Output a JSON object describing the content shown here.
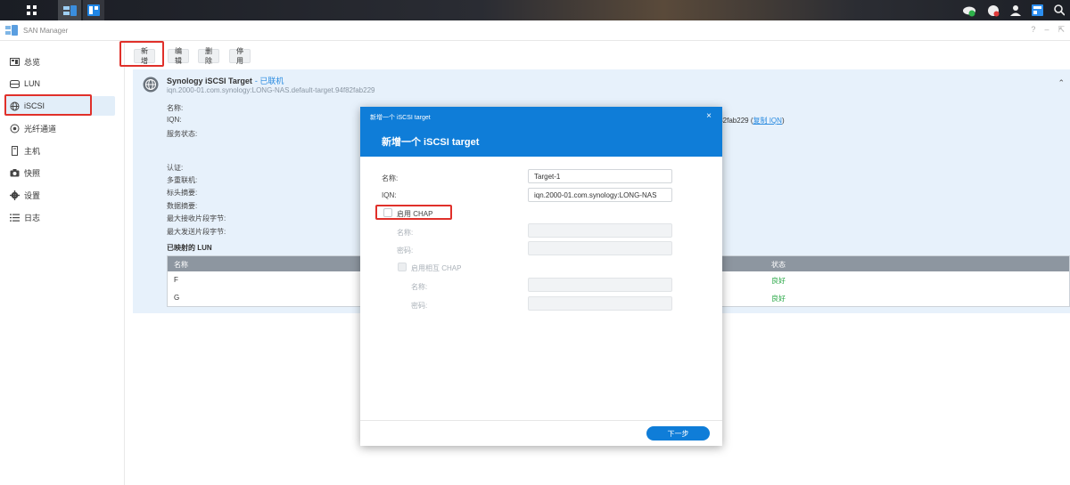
{
  "app": {
    "title": "SAN Manager"
  },
  "toolbar": {
    "add": "新增",
    "edit": "编辑",
    "delete": "删除",
    "disable": "停用"
  },
  "sidebar": {
    "items": [
      {
        "label": "总览",
        "icon": "dashboard-icon"
      },
      {
        "label": "LUN",
        "icon": "lun-icon"
      },
      {
        "label": "iSCSI",
        "icon": "globe-icon"
      },
      {
        "label": "光纤通道",
        "icon": "fiber-channel-icon"
      },
      {
        "label": "主机",
        "icon": "host-icon"
      },
      {
        "label": "快照",
        "icon": "camera-icon"
      },
      {
        "label": "设置",
        "icon": "gear-icon"
      },
      {
        "label": "日志",
        "icon": "list-icon"
      }
    ]
  },
  "target": {
    "name": "Synology iSCSI Target",
    "status": "- 已联机",
    "iqn": "iqn.2000-01.com.synology:LONG-NAS.default-target.94f82fab229",
    "labels": {
      "name": "名称:",
      "iqn": "IQN:",
      "service_status": "服务状态:",
      "auth": "认证:",
      "multi_session": "多重联机:",
      "header_digest": "标头摘要:",
      "data_digest": "数据摘要:",
      "max_recv": "最大接收片段字节:",
      "max_send": "最大发送片段字节:"
    },
    "iqn_tail": "f82fab229",
    "copy_iqn": "复制 IQN",
    "mapped_lun_title": "已映射的 LUN",
    "lun_table": {
      "col_name": "名称",
      "col_status": "状态",
      "rows": [
        {
          "name": "F",
          "status": "良好"
        },
        {
          "name": "G",
          "status": "良好"
        }
      ]
    }
  },
  "modal": {
    "small_title": "新增一个 iSCSI target",
    "title": "新增一个 iSCSI target",
    "close": "×",
    "name_label": "名称:",
    "name_value": "Target-1",
    "iqn_label": "IQN:",
    "iqn_value": "iqn.2000-01.com.synology:LONG-NAS",
    "chap_label": "启用 CHAP",
    "chap_name_label": "名称:",
    "chap_password_label": "密码:",
    "mutual_chap_label": "启用相互 CHAP",
    "mutual_name_label": "名称:",
    "mutual_password_label": "密码:",
    "next": "下一步"
  },
  "colors": {
    "accent": "#0f7dd8",
    "highlight": "#e0302a",
    "ok": "#28a745"
  }
}
